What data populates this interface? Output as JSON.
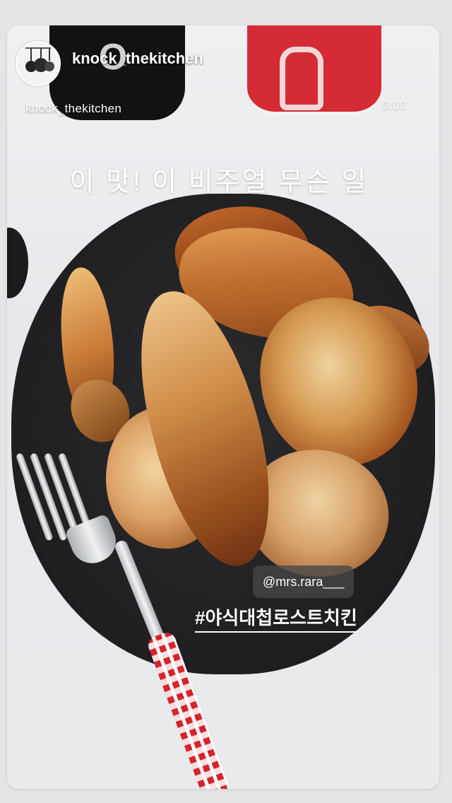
{
  "story": {
    "username": "knock_thekitchen",
    "subname": "knock_thekitchen",
    "timer": "0:00",
    "caption": "이 맛! 이 비주얼 무슨 일",
    "mention": "@mrs.rara___",
    "hashtag": "#야식대첩로스트치킨",
    "avatar_icon": "kitchen-pans-icon"
  },
  "colors": {
    "plate": "#222224",
    "can_red": "#d52b35",
    "can_dark": "#121212",
    "fork_handle_red": "#d6232c",
    "background": "#e4e5e6"
  }
}
